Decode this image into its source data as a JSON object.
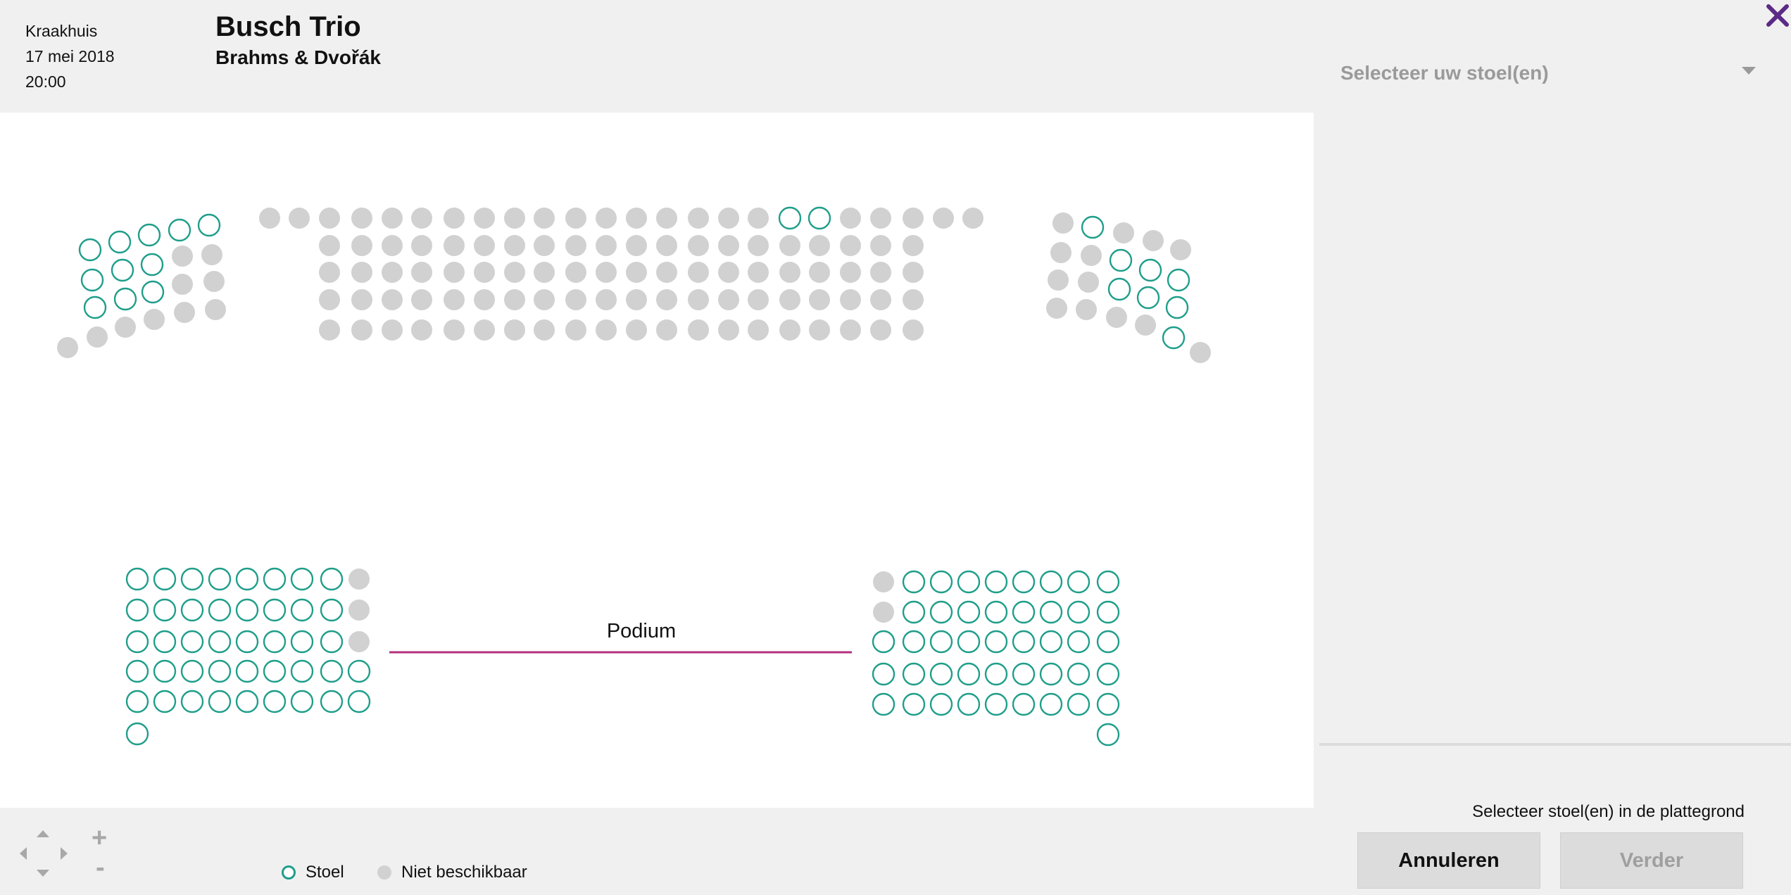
{
  "header": {
    "venue": "Kraakhuis",
    "date": "17 mei 2018",
    "time": "20:00",
    "title": "Busch Trio",
    "subtitle": "Brahms & Dvořák"
  },
  "map": {
    "podium_label": "Podium",
    "colors": {
      "free": "#1f9e8a",
      "taken": "#d1d1d1",
      "podium_line": "#b5307f"
    }
  },
  "sidepanel": {
    "close_icon": "close-icon",
    "seat_select_label": "Selecteer uw stoel(en)",
    "hint": "Selecteer stoel(en) in de plattegrond",
    "cancel_label": "Annuleren",
    "next_label": "Verder",
    "close_color": "#5b2a86"
  },
  "controls": {
    "zoom_in": "+",
    "zoom_out": "-"
  },
  "legend": {
    "free_label": "Stoel",
    "taken_label": "Niet beschikbaar"
  }
}
